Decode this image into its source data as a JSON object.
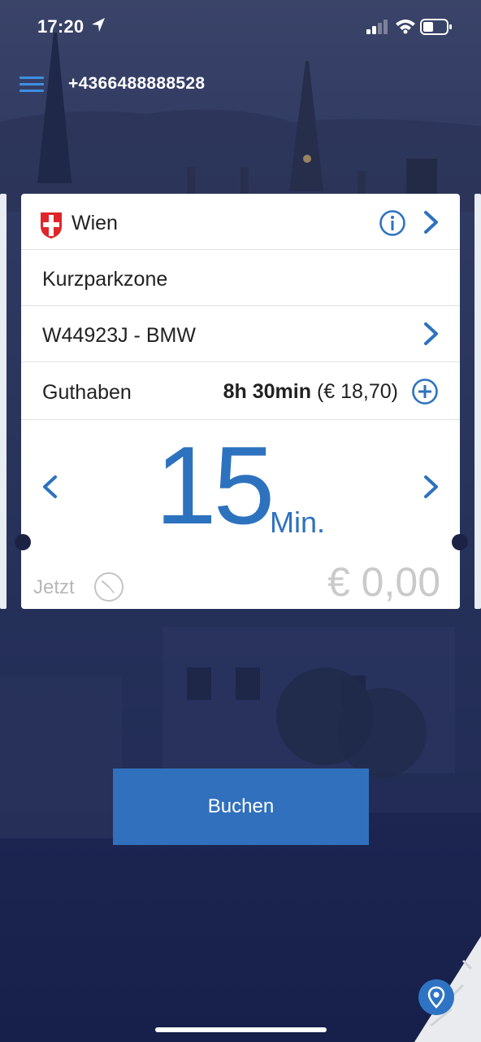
{
  "status_bar": {
    "time": "17:20"
  },
  "header": {
    "phone_number": "+4366488888528"
  },
  "card": {
    "city": "Wien",
    "zone": "Kurzparkzone",
    "vehicle": "W44923J - BMW",
    "balance_label": "Guthaben",
    "balance_time": "8h 30min",
    "balance_amount": "(€ 18,70)",
    "duration_value": "15",
    "duration_unit": "Min.",
    "start_label": "Jetzt",
    "price": "€ 0,00"
  },
  "actions": {
    "book_label": "Buchen"
  },
  "icons": {
    "menu": "hamburger-menu-icon",
    "info": "info-icon",
    "add": "plus-circle-icon",
    "location": "location-pin-icon"
  },
  "colors": {
    "accent": "#2d72bf",
    "button": "#3170bd",
    "background": "#1b2550"
  }
}
